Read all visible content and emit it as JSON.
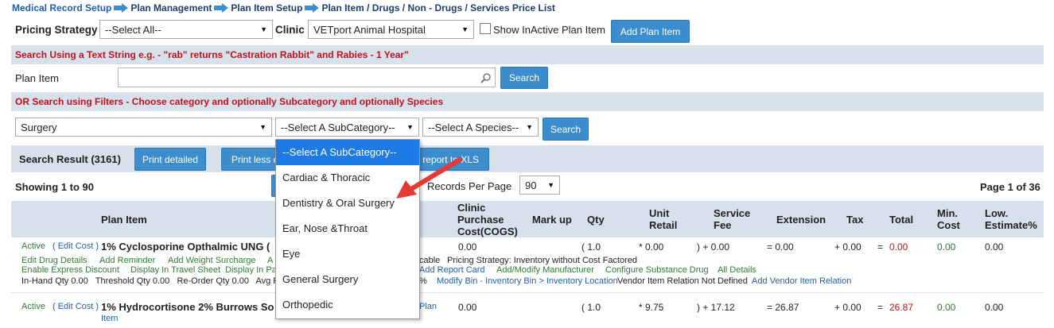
{
  "breadcrumb": {
    "items": [
      "Medical Record Setup",
      "Plan Management",
      "Plan Item Setup",
      "Plan Item / Drugs / Non - Drugs / Services Price List"
    ]
  },
  "filters": {
    "pricing_strategy_label": "Pricing Strategy",
    "pricing_strategy_value": "--Select All--",
    "clinic_label": "Clinic",
    "clinic_value": "VETport Animal Hospital",
    "show_inactive_label": "Show InActive Plan Item",
    "add_plan_item": "Add Plan Item"
  },
  "text_search": {
    "hint": "Search Using a Text String e.g. - \"rab\" returns \"Castration Rabbit\" and Rabies - 1 Year\"",
    "plan_item_label": "Plan Item",
    "plan_item_value": "",
    "search_button": "Search"
  },
  "filter_search": {
    "hint": "OR Search using Filters - Choose category and optionally Subcategory and optionally Species",
    "category_value": "Surgery",
    "subcategory_value": "--Select A SubCategory--",
    "species_value": "--Select A Species--",
    "search_button": "Search"
  },
  "dropdown": {
    "options": [
      "--Select A SubCategory--",
      "Cardiac & Thoracic",
      "Dentistry & Oral Surgery",
      "Ear, Nose &Throat",
      "Eye",
      "General Surgery",
      "Orthopedic"
    ]
  },
  "results": {
    "title": "Search Result (3161)",
    "print_detailed": "Print detailed",
    "print_less": "Print less d",
    "export_xls": "d report to XLS",
    "showing": "Showing 1 to 90",
    "records_label": "Records Per Page",
    "records_value": "90",
    "page_info": "Page 1 of 36"
  },
  "table": {
    "headers": {
      "plan_item": "Plan Item",
      "cogs": "Clinic Purchase Cost(COGS)",
      "markup": "Mark up",
      "qty": "Qty",
      "unit_retail": "Unit Retail",
      "service_fee": "Service Fee",
      "extension": "Extension",
      "tax": "Tax",
      "total": "Total",
      "min_cost": "Min. Cost",
      "low_estimate": "Low. Estimate%"
    },
    "row1": {
      "status": "Active",
      "edit": "( Edit Cost )",
      "name": "1% Cyclosporine Opthalmic UNG (",
      "cogs": "0.00",
      "qty": "( 1.0",
      "unit_retail": "* 0.00",
      "service_fee": ") + 0.00",
      "extension": "= 0.00",
      "tax": "+ 0.00",
      "total_eq": "=",
      "total": "0.00",
      "min_cost": "0.00",
      "low_estimate": "0.00",
      "links1": [
        "Edit Drug Details",
        "Add Reminder",
        "Add Weight Surcharge",
        "A"
      ],
      "taxable": "cable",
      "pricing_strategy": "Pricing Strategy: Inventory without Cost Factored",
      "links2": [
        "Enable Express Discount",
        "Display In Travel Sheet",
        "Display In Pa"
      ],
      "links2b": [
        "Add Report Card",
        "Add/Modify Manufacturer",
        "Configure Substance Drug",
        "All Details"
      ],
      "line3": "In-Hand Qty 0.00   Threshold Qty 0.00   Re-Order Qty 0.00   Avg Puro",
      "line3b": "%",
      "modify_bin": "Modify Bin - Inventory Bin > Inventory Location",
      "vendor_rel": "Vendor Item Relation Not Defined",
      "add_vendor": "Add Vendor Item Relation"
    },
    "row2": {
      "status": "Active",
      "edit": "( Edit Cost )",
      "name": "1% Hydrocortisone 2% Burrows So",
      "plan": "Plan",
      "item": "Item",
      "cogs": "0.00",
      "qty": "( 1.0",
      "unit_retail": "* 9.75",
      "service_fee": ") + 17.12",
      "extension": "= 26.87",
      "tax": "+ 0.00",
      "total_eq": "=",
      "total": "26.87",
      "min_cost": "0.00",
      "low_estimate": "0.00"
    }
  },
  "colors": {
    "accent": "#3c8dce",
    "band": "#d6e1ec",
    "red": "#c0121e",
    "green": "#2e7d32",
    "link": "#1f5fa8",
    "highlight": "#1e7ae4",
    "arrow": "#e53935"
  },
  "icons": {
    "breadcrumb": "arrow-right-icon",
    "search": "magnifier-icon",
    "annotation": "red-arrow-icon"
  }
}
